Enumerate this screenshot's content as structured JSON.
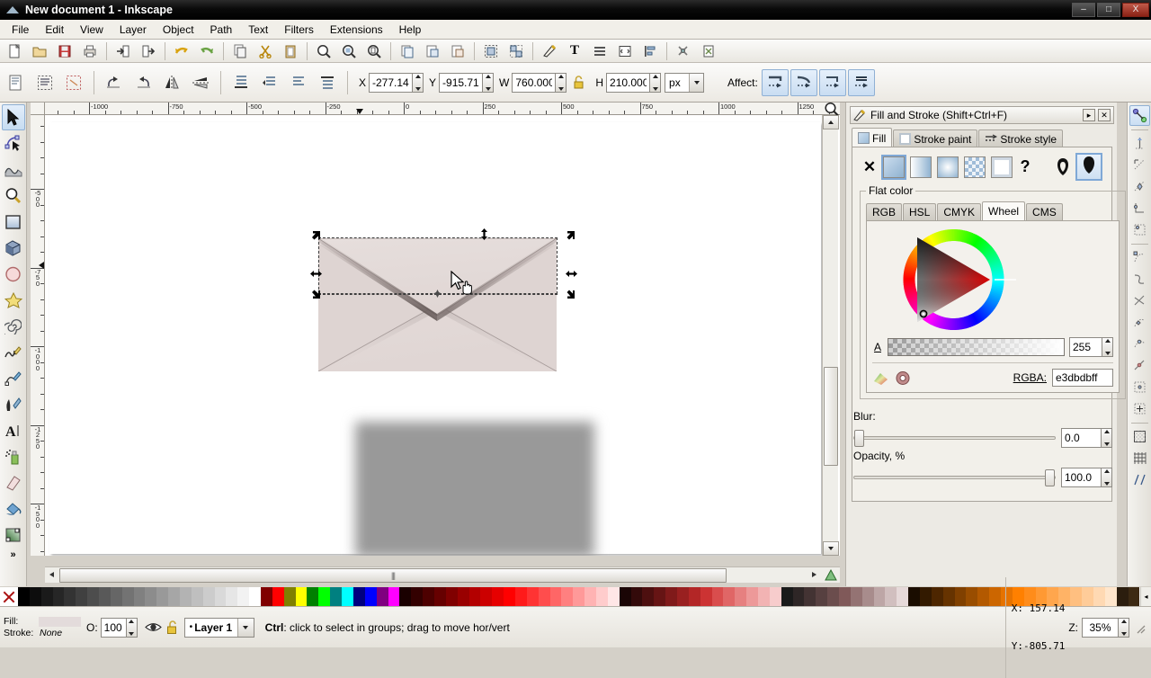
{
  "window": {
    "title": "New document 1 - Inkscape",
    "minimize": "–",
    "maximize": "□",
    "close": "X"
  },
  "menu": {
    "items": [
      "File",
      "Edit",
      "View",
      "Layer",
      "Object",
      "Path",
      "Text",
      "Filters",
      "Extensions",
      "Help"
    ]
  },
  "toolbar_commands": {
    "buttons": [
      {
        "name": "new-document",
        "icon": "page"
      },
      {
        "name": "open-document",
        "icon": "folder"
      },
      {
        "name": "save-document",
        "icon": "floppy"
      },
      {
        "name": "print-document",
        "icon": "printer"
      },
      {
        "name": "import",
        "icon": "import-arrow"
      },
      {
        "name": "export",
        "icon": "export-arrow"
      },
      {
        "name": "undo",
        "icon": "undo-arrow"
      },
      {
        "name": "redo",
        "icon": "redo-arrow"
      },
      {
        "name": "copy",
        "icon": "copy"
      },
      {
        "name": "cut",
        "icon": "scissors"
      },
      {
        "name": "paste",
        "icon": "clipboard"
      },
      {
        "name": "zoom-selection",
        "icon": "magnifier"
      },
      {
        "name": "zoom-drawing",
        "icon": "magnifier-drawing"
      },
      {
        "name": "zoom-page",
        "icon": "magnifier-page"
      },
      {
        "name": "duplicate",
        "icon": "duplicate"
      },
      {
        "name": "clone",
        "icon": "clone"
      },
      {
        "name": "unlink-clone",
        "icon": "unlink-clone"
      },
      {
        "name": "group",
        "icon": "group"
      },
      {
        "name": "ungroup",
        "icon": "ungroup"
      },
      {
        "name": "fill-and-stroke",
        "icon": "brush"
      },
      {
        "name": "text-and-font",
        "icon": "text-T"
      },
      {
        "name": "xml-editor",
        "icon": "xml"
      },
      {
        "name": "align-and-distribute",
        "icon": "align"
      },
      {
        "name": "document-properties",
        "icon": "doc-props"
      },
      {
        "name": "preferences",
        "icon": "wrench"
      },
      {
        "name": "inkscape-preferences",
        "icon": "gear-paint"
      }
    ]
  },
  "tool_options": {
    "left_buttons": [
      {
        "name": "select-all",
        "icon": "select-all"
      },
      {
        "name": "select-all-layers",
        "icon": "select-all-layers"
      },
      {
        "name": "deselect",
        "icon": "deselect"
      },
      {
        "name": "rotate-ccw",
        "icon": "rotate-ccw"
      },
      {
        "name": "rotate-cw",
        "icon": "rotate-cw"
      },
      {
        "name": "flip-horizontal",
        "icon": "flip-h"
      },
      {
        "name": "flip-vertical",
        "icon": "flip-v"
      },
      {
        "name": "lower-to-bottom",
        "icon": "lower-bottom"
      },
      {
        "name": "lower-step",
        "icon": "lower"
      },
      {
        "name": "raise-step",
        "icon": "raise"
      },
      {
        "name": "raise-to-top",
        "icon": "raise-top"
      }
    ],
    "x_label": "X",
    "x_value": "-277.14",
    "y_label": "Y",
    "y_value": "-915.71",
    "w_label": "W",
    "w_value": "760.000",
    "lock_label": "lock-ratio",
    "h_label": "H",
    "h_value": "210.000",
    "unit": "px",
    "affect_label": "Affect:",
    "affect_buttons": [
      {
        "name": "affect-stroke-width",
        "active": true
      },
      {
        "name": "affect-rounded-corners",
        "active": true
      },
      {
        "name": "affect-gradients",
        "active": true
      },
      {
        "name": "affect-patterns",
        "active": true
      }
    ]
  },
  "toolbox": {
    "tools": [
      {
        "name": "selector-tool",
        "icon": "arrow-pointer",
        "selected": true
      },
      {
        "name": "node-tool",
        "icon": "node-edit"
      },
      {
        "name": "tweak-tool",
        "icon": "tweak"
      },
      {
        "name": "zoom-tool",
        "icon": "magnifier"
      },
      {
        "name": "rectangle-tool",
        "icon": "rectangle"
      },
      {
        "name": "box3d-tool",
        "icon": "cube-3d"
      },
      {
        "name": "ellipse-tool",
        "icon": "ellipse"
      },
      {
        "name": "star-tool",
        "icon": "star"
      },
      {
        "name": "spiral-tool",
        "icon": "spiral"
      },
      {
        "name": "pencil-tool",
        "icon": "pencil"
      },
      {
        "name": "pen-tool",
        "icon": "bezier-pen"
      },
      {
        "name": "calligraphy-tool",
        "icon": "calligraphy"
      },
      {
        "name": "text-tool",
        "icon": "text-A"
      },
      {
        "name": "spray-tool",
        "icon": "spray-can"
      },
      {
        "name": "eraser-tool",
        "icon": "eraser"
      },
      {
        "name": "paint-bucket-tool",
        "icon": "paint-bucket"
      },
      {
        "name": "gradient-tool",
        "icon": "gradient"
      }
    ],
    "more_label": "»"
  },
  "rulers": {
    "horizontal_labels": [
      "-1000",
      "-750",
      "-500",
      "-250",
      "0",
      "250",
      "500",
      "750",
      "1000",
      "1250"
    ],
    "vertical_labels": [
      "-500",
      "-750",
      "-1000",
      "-1250",
      "-1500"
    ],
    "zoom_to_fit_icon": "magnifier-fit"
  },
  "canvas": {
    "envelope": {
      "name": "envelope-object",
      "fill_color": "#e3dbdb",
      "shadow_color": "#6f6565"
    },
    "blurred_rect": {
      "name": "blurred-rectangle",
      "color": "#999999"
    },
    "cursor": "arrow-with-hand-move"
  },
  "dock": {
    "title": "Fill and Stroke (Shift+Ctrl+F)",
    "pin_icon": "▸",
    "close_icon": "✕",
    "tabs": [
      {
        "label": "Fill",
        "icon": "fill-swatch",
        "selected": true
      },
      {
        "label": "Stroke paint",
        "icon": "stroke-swatch",
        "selected": false
      },
      {
        "label": "Stroke style",
        "icon": "stroke-style",
        "selected": false
      }
    ],
    "fill_types": [
      {
        "name": "no-paint",
        "glyph": "✕"
      },
      {
        "name": "flat-color",
        "selected": true
      },
      {
        "name": "linear-gradient",
        "selected": false
      },
      {
        "name": "radial-gradient",
        "selected": false
      },
      {
        "name": "pattern",
        "selected": false
      },
      {
        "name": "swatch",
        "selected": false
      },
      {
        "name": "unknown-paint",
        "glyph": "?"
      },
      {
        "name": "fill-rule-evenodd",
        "glyph": "evenodd"
      },
      {
        "name": "fill-rule-nonzero",
        "glyph": "nonzero",
        "selected": true
      }
    ],
    "flat_color_legend": "Flat color",
    "color_tabs": [
      {
        "label": "RGB",
        "selected": false
      },
      {
        "label": "HSL",
        "selected": false
      },
      {
        "label": "CMYK",
        "selected": false
      },
      {
        "label": "Wheel",
        "selected": true
      },
      {
        "label": "CMS",
        "selected": false
      }
    ],
    "alpha_label": "A",
    "alpha_value": "255",
    "rgba_label": "RGBA:",
    "rgba_value": "e3dbdbff",
    "pick_icons": [
      {
        "name": "color-picker-swatch-icon"
      },
      {
        "name": "color-wheel-target-icon"
      }
    ],
    "blur_label": "Blur:",
    "blur_value": "0.0",
    "blur_percent": 0,
    "opacity_label": "Opacity, %",
    "opacity_value": "100.0",
    "opacity_percent": 100
  },
  "snapbar": {
    "buttons": [
      {
        "name": "enable-snapping",
        "on": true
      },
      {
        "name": "snap-bounding-boxes",
        "on": false
      },
      {
        "name": "snap-bbox-edges",
        "on": false
      },
      {
        "name": "snap-bbox-corners",
        "on": false
      },
      {
        "name": "snap-bbox-edge-midpoints",
        "on": false
      },
      {
        "name": "snap-bbox-centers",
        "on": false
      },
      {
        "name": "snap-nodes-paths",
        "on": false
      },
      {
        "name": "snap-paths",
        "on": false
      },
      {
        "name": "snap-path-intersections",
        "on": false
      },
      {
        "name": "snap-cusp-nodes",
        "on": false
      },
      {
        "name": "snap-smooth-nodes",
        "on": false
      },
      {
        "name": "snap-line-midpoints",
        "on": false
      },
      {
        "name": "snap-object-centers",
        "on": false
      },
      {
        "name": "snap-rotation-centers",
        "on": false
      },
      {
        "name": "snap-page-border",
        "on": false
      },
      {
        "name": "snap-grids",
        "on": false
      },
      {
        "name": "snap-guides",
        "on": false
      }
    ]
  },
  "palette": {
    "x_swatch_name": "remove-color-swatch",
    "colors": [
      "#000000",
      "#0d0d0d",
      "#1a1a1a",
      "#262626",
      "#333333",
      "#404040",
      "#4d4d4d",
      "#595959",
      "#666666",
      "#737373",
      "#808080",
      "#8c8c8c",
      "#999999",
      "#a6a6a6",
      "#b3b3b3",
      "#bfbfbf",
      "#cccccc",
      "#d9d9d9",
      "#e6e6e6",
      "#f2f2f2",
      "#ffffff",
      "#800000",
      "#ff0000",
      "#808000",
      "#ffff00",
      "#008000",
      "#00ff00",
      "#008080",
      "#00ffff",
      "#000080",
      "#0000ff",
      "#800080",
      "#ff00ff",
      "#1a0000",
      "#330000",
      "#4d0000",
      "#660000",
      "#800000",
      "#990000",
      "#b30000",
      "#cc0000",
      "#e60000",
      "#ff0000",
      "#ff1a1a",
      "#ff3333",
      "#ff4d4d",
      "#ff6666",
      "#ff8080",
      "#ff9999",
      "#ffb3b3",
      "#ffcccc",
      "#ffe6e6",
      "#1a0505",
      "#330a0a",
      "#4d0f0f",
      "#661414",
      "#801a1a",
      "#992020",
      "#b32626",
      "#cc3333",
      "#d94d4d",
      "#e06666",
      "#e68080",
      "#ed9999",
      "#f2b3b3",
      "#f7cccc",
      "#1a1a1a",
      "#2e2626",
      "#433333",
      "#574040",
      "#6b4d4d",
      "#805959",
      "#947373",
      "#a88c8c",
      "#bda6a6",
      "#d1bfbf",
      "#e6d9d9",
      "#1a0d00",
      "#331a00",
      "#4d2600",
      "#663300",
      "#804000",
      "#994d00",
      "#b35900",
      "#cc6600",
      "#e67300",
      "#ff8000",
      "#ff8c1a",
      "#ff9933",
      "#ffa64d",
      "#ffb366",
      "#ffbf80",
      "#ffcc99",
      "#ffd9b3",
      "#ffe6cc",
      "#2b1d0e",
      "#3d2a14"
    ],
    "arrow_icon": "◂"
  },
  "statusbar": {
    "fill_label": "Fill:",
    "fill_color": "#e3dbdb",
    "stroke_label": "Stroke:",
    "stroke_value": "None",
    "opacity_label": "O:",
    "opacity_value": "100",
    "visibility_icon": "eye-icon",
    "lock_icon": "unlocked-padlock-icon",
    "layer_name": "Layer 1",
    "layer_bullet": "•",
    "message_prefix": "Ctrl",
    "message": ": click to select in groups; drag to move hor/vert",
    "x_label": "X:",
    "x_value": "157.14",
    "y_label": "Y:",
    "y_value": "-805.71",
    "zoom_label": "Z:",
    "zoom_value": "35%"
  }
}
